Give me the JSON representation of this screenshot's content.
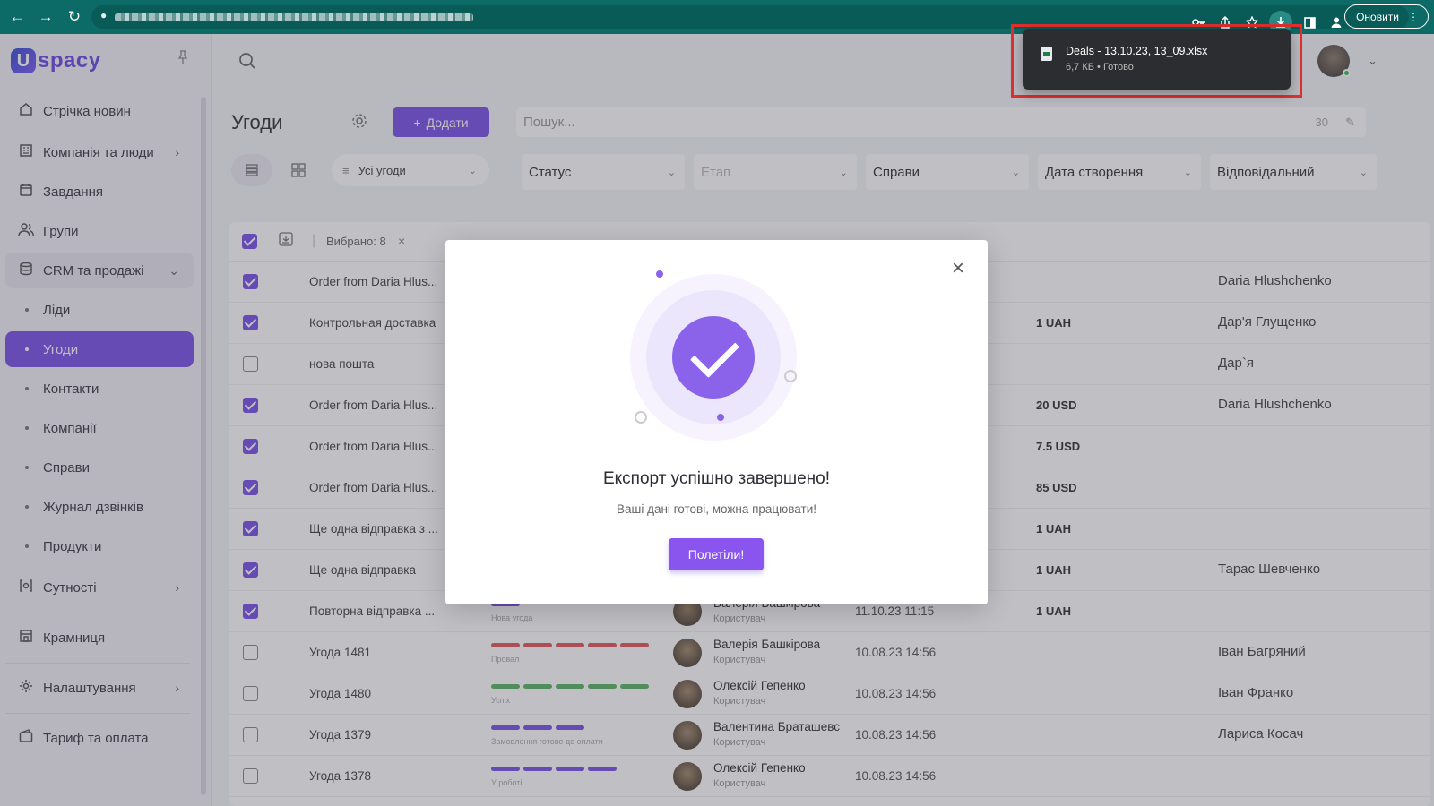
{
  "browser": {
    "back_icon": "←",
    "forward_icon": "→",
    "reload_icon": "↻",
    "lock_icon": "🔒",
    "update_label": "Оновити",
    "menu_icon": "⋮",
    "icons": [
      "key-icon",
      "share-icon",
      "star-icon",
      "download-icon",
      "sidepanel-icon",
      "profile-icon"
    ]
  },
  "download_popup": {
    "file_name": "Deals - 13.10.23, 13_09.xlsx",
    "meta": "6,7 КБ • Готово"
  },
  "app": {
    "logo_text": "spacy",
    "logo_letter": "U",
    "sidebar": {
      "items": [
        {
          "label": "Стрічка новин"
        },
        {
          "label": "Компанія та люди"
        },
        {
          "label": "Завдання"
        },
        {
          "label": "Групи"
        },
        {
          "label": "CRM та продажі"
        },
        {
          "label": "Ліди"
        },
        {
          "label": "Угоди"
        },
        {
          "label": "Контакти"
        },
        {
          "label": "Компанії"
        },
        {
          "label": "Справи"
        },
        {
          "label": "Журнал дзвінків"
        },
        {
          "label": "Продукти"
        },
        {
          "label": "Сутності"
        },
        {
          "label": "Крамниця"
        },
        {
          "label": "Налаштування"
        },
        {
          "label": "Тариф та оплата"
        }
      ]
    },
    "header": {
      "title": "Угоди",
      "add_label": "Додати",
      "search_placeholder": "Пошук...",
      "search_count": "30"
    },
    "view": {
      "all_deals_label": "Усі угоди"
    },
    "filters": [
      {
        "label": "Статус"
      },
      {
        "label": "Етап"
      },
      {
        "label": "Справи"
      },
      {
        "label": "Дата створення"
      },
      {
        "label": "Відповідальний"
      }
    ],
    "table": {
      "selected_label": "Вибрано: 8",
      "rows": [
        {
          "name": "Order from Daria Hlus...",
          "checked": true,
          "sum": "",
          "responsible": "Daria Hlushchenko"
        },
        {
          "name": "Контрольная доставка",
          "checked": true,
          "sum": "1 UAH",
          "responsible": "Дар'я Глущенко"
        },
        {
          "name": "нова пошта",
          "checked": false,
          "sum": "",
          "responsible": "Дар`я"
        },
        {
          "name": "Order from Daria Hlus...",
          "checked": true,
          "sum": "20 USD",
          "responsible": "Daria Hlushchenko"
        },
        {
          "name": "Order from Daria Hlus...",
          "checked": true,
          "sum": "7.5 USD",
          "responsible": ""
        },
        {
          "name": "Order from Daria Hlus...",
          "checked": true,
          "sum": "85 USD",
          "responsible": ""
        },
        {
          "name": "Ще одна відправка з ...",
          "checked": true,
          "sum": "1 UAH",
          "responsible": ""
        },
        {
          "name": "Ще одна відправка",
          "checked": true,
          "sum": "1 UAH",
          "responsible": "Тарас Шевченко"
        },
        {
          "name": "Повторна відправка ...",
          "checked": true,
          "sum": "1 UAH",
          "responsible": "",
          "stage": "Нова угода",
          "stage_color": "#7a55e6",
          "stage_segments": 1,
          "user": "Валерія Башкірова",
          "role": "Користувач",
          "date": "11.10.23 11:15"
        },
        {
          "name": "Угода 1481",
          "checked": false,
          "sum": "",
          "responsible": "Іван Багряний",
          "stage": "Провал",
          "stage_color": "#e05a5a",
          "stage_segments": 5,
          "user": "Валерія Башкірова",
          "role": "Користувач",
          "date": "10.08.23 14:56"
        },
        {
          "name": "Угода 1480",
          "checked": false,
          "sum": "",
          "responsible": "Іван Франко",
          "stage": "Успіх",
          "stage_color": "#5bb564",
          "stage_segments": 5,
          "user": "Олексій Гепенко",
          "role": "Користувач",
          "date": "10.08.23 14:56"
        },
        {
          "name": "Угода 1379",
          "checked": false,
          "sum": "",
          "responsible": "Лариса Косач",
          "stage": "Замовлення готове до оплати",
          "stage_color": "#7a55e6",
          "stage_segments": 3,
          "user": "Валентина Браташевс",
          "role": "Користувач",
          "date": "10.08.23 14:56"
        },
        {
          "name": "Угода 1378",
          "checked": false,
          "sum": "",
          "responsible": "",
          "stage": "У роботі",
          "stage_color": "#7a55e6",
          "stage_segments": 4,
          "user": "Олексій Гепенко",
          "role": "Користувач",
          "date": "10.08.23 14:56"
        }
      ]
    }
  },
  "modal": {
    "title": "Експорт успішно завершено!",
    "subtitle": "Ваші дані готові, можна працювати!",
    "button_label": "Полетіли!",
    "close_icon": "×"
  },
  "colors": {
    "accent": "#7a55e6",
    "browser_bar": "#0c6b67",
    "highlight_outline": "#e0302e"
  }
}
